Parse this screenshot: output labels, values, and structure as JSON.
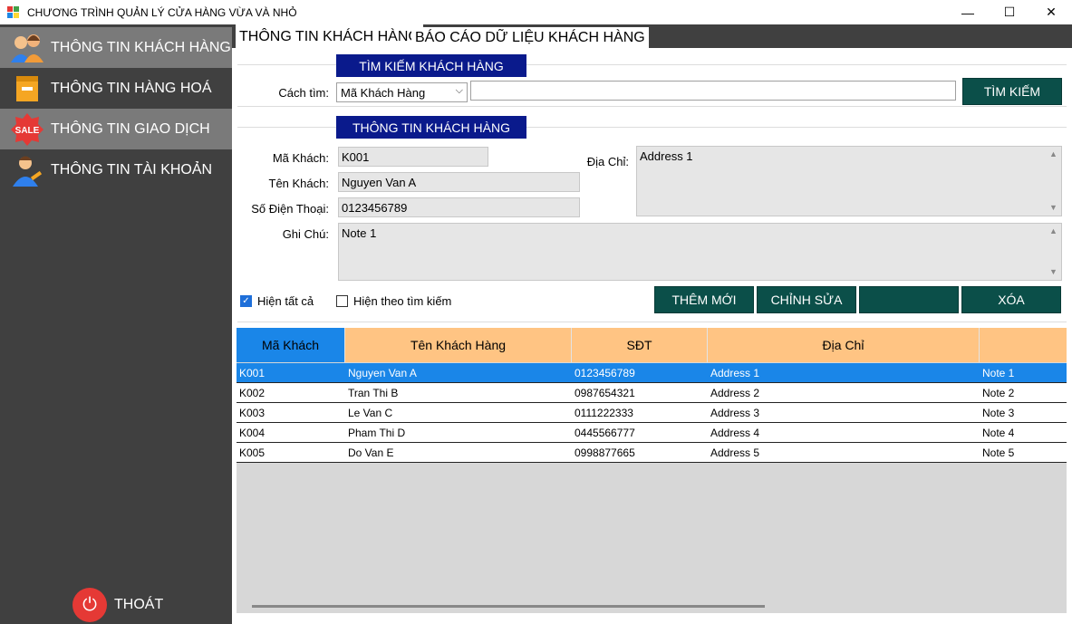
{
  "window": {
    "title": "CHƯƠNG TRÌNH QUẢN LÝ CỬA HÀNG VỪA VÀ NHỎ",
    "controls": [
      "—",
      "☐",
      "✕"
    ]
  },
  "sidebar": {
    "items": [
      {
        "label": "THÔNG TIN KHÁCH HÀNG",
        "icon": "customers-icon"
      },
      {
        "label": "THÔNG TIN HÀNG HOÁ",
        "icon": "goods-box-icon"
      },
      {
        "label": "THÔNG TIN GIAO DỊCH",
        "icon": "sale-tag-icon",
        "badge": "SALE"
      },
      {
        "label": "THÔNG TIN TÀI KHOẢN",
        "icon": "account-icon"
      }
    ],
    "exit_label": "THOÁT",
    "exit_glyph": "⏻"
  },
  "tabs": [
    "THÔNG TIN KHÁCH HÀNG",
    "BÁO CÁO DỮ LIỆU KHÁCH HÀNG"
  ],
  "search": {
    "header": "TÌM KIẾM KHÁCH HÀNG",
    "label": "Cách tìm:",
    "mode": "Mã Khách Hàng",
    "query": "",
    "button": "TÌM KIẾM"
  },
  "info": {
    "header": "THÔNG TIN KHÁCH HÀNG",
    "labels": {
      "id": "Mã Khách:",
      "name": "Tên Khách:",
      "phone": "Số Điện Thoại:",
      "address": "Địa Chỉ:",
      "note": "Ghi Chú:"
    },
    "values": {
      "id": "K001",
      "name": "Nguyen Van A",
      "phone": "0123456789",
      "address": "Address 1",
      "note": "Note 1"
    }
  },
  "options": {
    "show_all": "Hiện tất cả",
    "show_all_checked": true,
    "show_search": "Hiện theo tìm kiếm",
    "show_search_checked": false
  },
  "actions": {
    "add": "THÊM MỚI",
    "edit": "CHỈNH SỬA",
    "blank": "",
    "delete": "XÓA"
  },
  "table": {
    "columns": [
      "Mã Khách",
      "Tên Khách Hàng",
      "SĐT",
      "Địa Chỉ",
      ""
    ],
    "rows": [
      [
        "K001",
        "Nguyen Van A",
        "0123456789",
        "Address 1",
        "Note 1"
      ],
      [
        "K002",
        "Tran Thi B",
        "0987654321",
        "Address 2",
        "Note 2"
      ],
      [
        "K003",
        "Le Van C",
        "0111222333",
        "Address 3",
        "Note 3"
      ],
      [
        "K004",
        "Pham Thi D",
        "0445566777",
        "Address 4",
        "Note 4"
      ],
      [
        "K005",
        "Do Van E",
        "0998877665",
        "Address 5",
        "Note 5"
      ]
    ],
    "selected_row": 0
  },
  "colors": {
    "sidebar": "#404040",
    "sidebar_active": "#7a7a7a",
    "header_blue": "#0a1a8c",
    "button_teal": "#0b4f49",
    "grid_header": "#ffc483",
    "selection": "#1a86e8"
  }
}
